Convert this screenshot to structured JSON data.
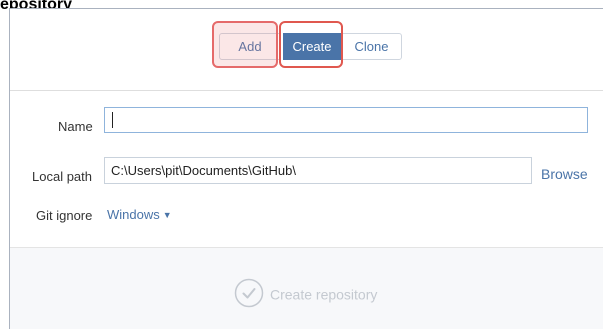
{
  "window": {
    "title_fragment": "epository"
  },
  "tabs": {
    "add_label": "Add",
    "create_label": "Create",
    "clone_label": "Clone",
    "selected": "Create"
  },
  "form": {
    "name_label": "Name",
    "name_value": "",
    "local_path_label": "Local path",
    "local_path_value": "C:\\Users\\pit\\Documents\\GitHub\\",
    "browse_label": "Browse",
    "git_ignore_label": "Git ignore",
    "git_ignore_value": "Windows"
  },
  "footer": {
    "create_repository_label": "Create repository",
    "create_repository_enabled": false
  },
  "colors": {
    "accent": "#4a74a8",
    "highlight": "#e56a6a",
    "disabled": "#c4c9d0"
  },
  "icons": {
    "checkmark": "check-circle-icon",
    "dropdown": "chevron-down-icon"
  }
}
